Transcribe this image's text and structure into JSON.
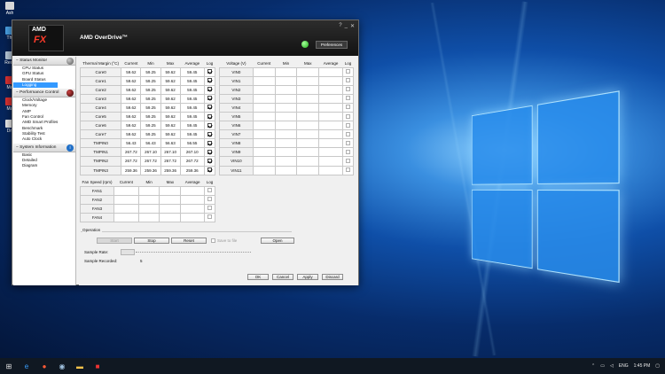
{
  "window": {
    "title": "AMD OverDrive™",
    "logo_top": "AMD",
    "logo_main": "FX",
    "preferences_label": "Preferences"
  },
  "desktop": {
    "icons": [
      "Ash",
      "Thi",
      "Recy",
      "Ma",
      "Ma",
      "Dri"
    ]
  },
  "sidebar": {
    "sections": [
      {
        "label": "Status Monitor",
        "items": [
          "CPU Status",
          "GPU Status",
          "Board Status",
          "Logging"
        ]
      },
      {
        "label": "Performance Control",
        "items": [
          "Clock/Voltage",
          "Memory",
          "AMP",
          "Fan Control",
          "AMD Smart Profiles",
          "Benchmark",
          "Stability Test",
          "Auto Clock"
        ]
      },
      {
        "label": "System Information",
        "items": [
          "Basic",
          "Detailed",
          "Diagram"
        ]
      }
    ],
    "active_item": "Logging"
  },
  "thermal_table": {
    "headers": [
      "Thermal Margin (°C)",
      "Current",
      "Min",
      "Max",
      "Average",
      "Log"
    ],
    "rows": [
      {
        "name": "Core0",
        "current": "59.62",
        "min": "59.25",
        "max": "59.62",
        "average": "59.45",
        "log": true
      },
      {
        "name": "Core1",
        "current": "59.62",
        "min": "59.25",
        "max": "59.62",
        "average": "59.45",
        "log": true
      },
      {
        "name": "Core2",
        "current": "59.62",
        "min": "59.25",
        "max": "59.62",
        "average": "59.45",
        "log": true
      },
      {
        "name": "Core3",
        "current": "59.62",
        "min": "59.25",
        "max": "59.62",
        "average": "59.45",
        "log": true
      },
      {
        "name": "Core4",
        "current": "59.62",
        "min": "59.25",
        "max": "59.62",
        "average": "59.45",
        "log": true
      },
      {
        "name": "Core5",
        "current": "59.62",
        "min": "59.25",
        "max": "59.62",
        "average": "59.45",
        "log": true
      },
      {
        "name": "Core6",
        "current": "59.62",
        "min": "59.25",
        "max": "59.62",
        "average": "59.45",
        "log": true
      },
      {
        "name": "Core7",
        "current": "59.62",
        "min": "59.25",
        "max": "59.62",
        "average": "59.45",
        "log": true
      },
      {
        "name": "TMPIN0",
        "current": "56.43",
        "min": "56.43",
        "max": "56.63",
        "average": "56.55",
        "log": true
      },
      {
        "name": "TMPIN1",
        "current": "267.72",
        "min": "267.10",
        "max": "267.10",
        "average": "267.10",
        "log": true
      },
      {
        "name": "TMPIN2",
        "current": "267.72",
        "min": "267.72",
        "max": "267.72",
        "average": "267.72",
        "log": true
      },
      {
        "name": "TMPIN3",
        "current": "259.36",
        "min": "259.36",
        "max": "259.36",
        "average": "259.36",
        "log": true
      }
    ]
  },
  "voltage_table": {
    "headers": [
      "Voltage (V)",
      "Current",
      "Min",
      "Max",
      "Average",
      "Log"
    ],
    "rows": [
      "VIN0",
      "VIN1",
      "VIN2",
      "VIN3",
      "VIN4",
      "VIN5",
      "VIN6",
      "VIN7",
      "VIN8",
      "VIN9",
      "VIN10",
      "VIN11"
    ]
  },
  "fan_table": {
    "headers": [
      "Fan Speed (rpm)",
      "Current",
      "Min",
      "Max",
      "Average",
      "Log"
    ],
    "rows": [
      "FAN1",
      "FAN2",
      "FAN3",
      "FAN4"
    ]
  },
  "operation": {
    "label": "Operation",
    "start": "Start",
    "stop": "Stop",
    "reset": "Reset",
    "save_to_file": "Save to file",
    "open": "Open",
    "sample_rate_label": "Sample Rate:",
    "sample_recorded_label": "Sample Recorded:",
    "sample_recorded_value": "5"
  },
  "footer": {
    "ok": "OK",
    "cancel": "Cancel",
    "apply": "Apply",
    "discard": "Discard"
  },
  "taskbar": {
    "language": "ENG",
    "time": "1:45 PM"
  },
  "colors": {
    "accent": "#3399ff",
    "status_ok": "#1fae1a",
    "brand_red": "#ff3b2a"
  }
}
